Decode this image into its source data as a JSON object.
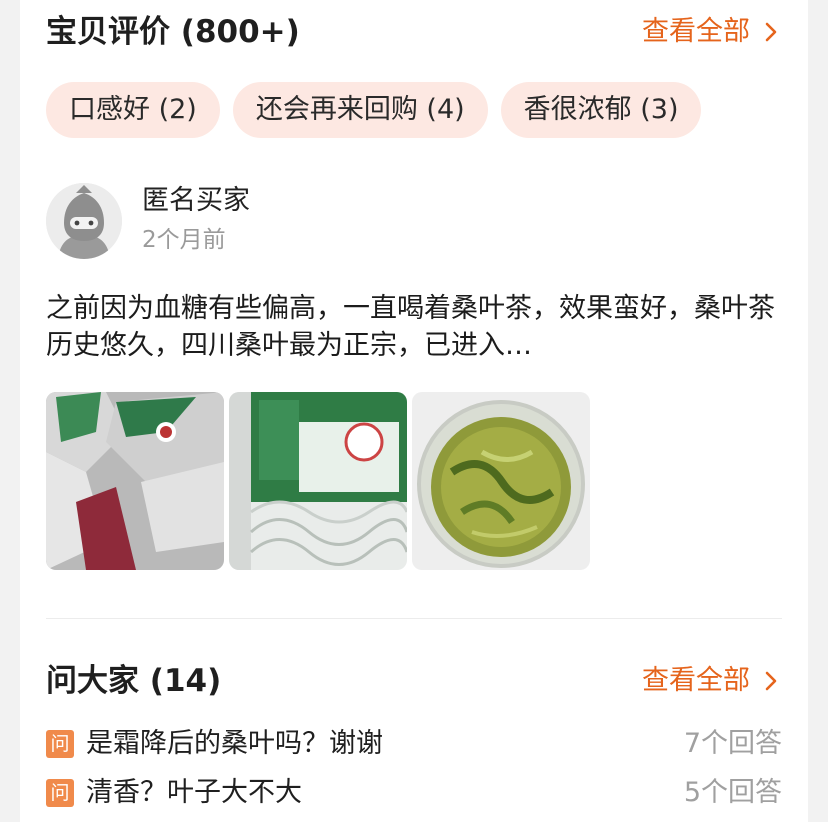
{
  "reviews": {
    "title": "宝贝评价 (800+)",
    "see_all": "查看全部",
    "tags": [
      "口感好 (2)",
      "还会再来回购 (4)",
      "香很浓郁 (3)"
    ],
    "review": {
      "user_name": "匿名买家",
      "time": "2个月前",
      "text": "之前因为血糖有些偏高，一直喝着桑叶茶，效果蛮好，桑叶茶历史悠久，四川桑叶最为正宗，已进入…",
      "photo_count": 3
    }
  },
  "ask": {
    "title": "问大家 (14)",
    "see_all": "查看全部",
    "badge": "问",
    "questions": [
      {
        "text": "是霜降后的桑叶吗？谢谢",
        "answers": "7个回答"
      },
      {
        "text": "清香？叶子大不大",
        "answers": "5个回答"
      }
    ]
  },
  "colors": {
    "accent": "#e5641c",
    "tag_bg": "#fde8e2",
    "badge": "#f08a4b"
  },
  "icons": {
    "see_all": "chevron-right-icon",
    "avatar": "default-avatar-icon"
  }
}
